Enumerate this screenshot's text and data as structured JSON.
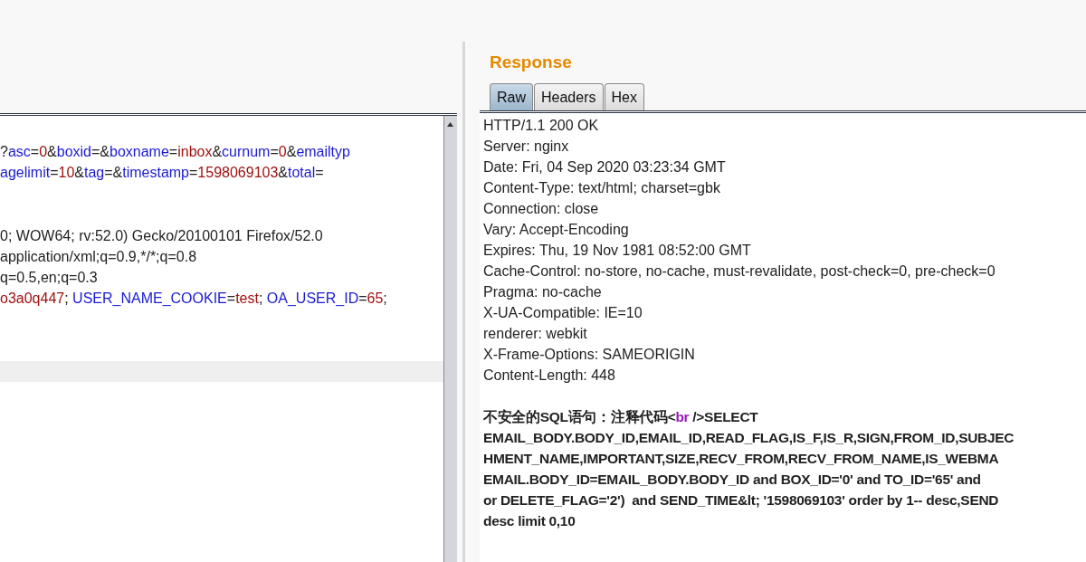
{
  "request": {
    "blocks": [
      [
        [
          {
            "kind": "p",
            "text": "?"
          },
          {
            "kind": "k",
            "text": "asc"
          },
          {
            "kind": "p",
            "text": "="
          },
          {
            "kind": "v",
            "text": "0"
          },
          {
            "kind": "p",
            "text": "&"
          },
          {
            "kind": "k",
            "text": "boxid"
          },
          {
            "kind": "p",
            "text": "=&"
          },
          {
            "kind": "k",
            "text": "boxname"
          },
          {
            "kind": "p",
            "text": "="
          },
          {
            "kind": "v",
            "text": "inbox"
          },
          {
            "kind": "p",
            "text": "&"
          },
          {
            "kind": "k",
            "text": "curnum"
          },
          {
            "kind": "p",
            "text": "="
          },
          {
            "kind": "v",
            "text": "0"
          },
          {
            "kind": "p",
            "text": "&"
          },
          {
            "kind": "k",
            "text": "emailtyp"
          }
        ],
        [
          {
            "kind": "k",
            "text": "agelimit"
          },
          {
            "kind": "p",
            "text": "="
          },
          {
            "kind": "v",
            "text": "10"
          },
          {
            "kind": "p",
            "text": "&"
          },
          {
            "kind": "k",
            "text": "tag"
          },
          {
            "kind": "p",
            "text": "=&"
          },
          {
            "kind": "k",
            "text": "timestamp"
          },
          {
            "kind": "p",
            "text": "="
          },
          {
            "kind": "v",
            "text": "1598069103"
          },
          {
            "kind": "p",
            "text": "&"
          },
          {
            "kind": "k",
            "text": "total"
          },
          {
            "kind": "p",
            "text": "="
          }
        ]
      ],
      [
        [
          {
            "kind": "p",
            "text": "0; WOW64; rv:52.0) Gecko/20100101 Firefox/52.0"
          }
        ],
        [
          {
            "kind": "p",
            "text": "application/xml;q=0.9,*/*;q=0.8"
          }
        ],
        [
          {
            "kind": "p",
            "text": "q=0.5,en;q=0.3"
          }
        ],
        [
          {
            "kind": "v",
            "text": "o3a0q447"
          },
          {
            "kind": "p",
            "text": "; "
          },
          {
            "kind": "k",
            "text": "USER_NAME_COOKIE"
          },
          {
            "kind": "p",
            "text": "="
          },
          {
            "kind": "v",
            "text": "test"
          },
          {
            "kind": "p",
            "text": "; "
          },
          {
            "kind": "k",
            "text": "OA_USER_ID"
          },
          {
            "kind": "p",
            "text": "="
          },
          {
            "kind": "v",
            "text": "65"
          },
          {
            "kind": "p",
            "text": ";"
          }
        ]
      ]
    ]
  },
  "response": {
    "title": "Response",
    "tabs": [
      {
        "label": "Raw",
        "selected": true
      },
      {
        "label": "Headers",
        "selected": false
      },
      {
        "label": "Hex",
        "selected": false
      }
    ],
    "headers": [
      "HTTP/1.1 200 OK",
      "Server: nginx",
      "Date: Fri, 04 Sep 2020 03:23:34 GMT",
      "Content-Type: text/html; charset=gbk",
      "Connection: close",
      "Vary: Accept-Encoding",
      "Expires: Thu, 19 Nov 1981 08:52:00 GMT",
      "Cache-Control: no-store, no-cache, must-revalidate, post-check=0, pre-check=0",
      "Pragma: no-cache",
      "X-UA-Compatible: IE=10",
      "renderer: webkit",
      "X-Frame-Options: SAMEORIGIN",
      "Content-Length: 448"
    ],
    "body": [
      [
        {
          "kind": "p",
          "text": "不安全的SQL语句：注释代码"
        },
        {
          "kind": "p",
          "text": "<"
        },
        {
          "kind": "t",
          "text": "br"
        },
        {
          "kind": "p",
          "text": " />SELECT"
        }
      ],
      [
        {
          "kind": "p",
          "text": "EMAIL_BODY.BODY_ID,EMAIL_ID,READ_FLAG,IS_F,IS_R,SIGN,FROM_ID,SUBJEC"
        }
      ],
      [
        {
          "kind": "p",
          "text": "HMENT_NAME,IMPORTANT,SIZE,RECV_FROM,RECV_FROM_NAME,IS_WEBMA"
        }
      ],
      [
        {
          "kind": "p",
          "text": "EMAIL.BODY_ID=EMAIL_BODY.BODY_ID and BOX_ID='0' and TO_ID='65' and"
        }
      ],
      [
        {
          "kind": "p",
          "text": "or DELETE_FLAG='2')  and SEND_TIME&lt; '1598069103' order by 1-- desc,SEND"
        }
      ],
      [
        {
          "kind": "p",
          "text": "desc limit 0,10"
        }
      ]
    ]
  }
}
